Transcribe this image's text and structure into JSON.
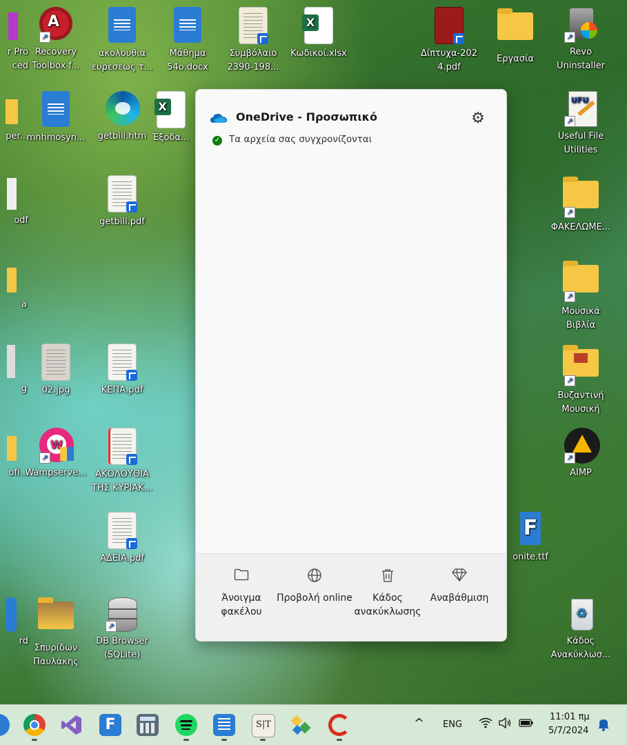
{
  "desktop": {
    "col0": {
      "label_row1": "r Pro\nced",
      "label_row2": "per...",
      "label_row3": "odf",
      "label_row4": "a",
      "label_row5": "g",
      "label_row6": "ofi...",
      "label_row7": "rd"
    },
    "col1": {
      "recovery": "Recovery Toolbox f...",
      "mnhmosyn": "mnhmosyn...",
      "jpg02": "02.jpg",
      "wampserver": "Wampserve...",
      "spyridon": "Σπυρίδων Παυλάκης"
    },
    "col2": {
      "akolouthia": "ακολουθια ευρεσεως τ...",
      "getbill_htm": "getbill.htm",
      "getbill_pdf": "getbill.pdf",
      "kepa": "ΚΕΠΑ.pdf",
      "akolouthia_kyriak": "ΑΚΟΛΟΥΘΙΑ ΤΗΣ ΚΥΡΙΑΚ...",
      "adeia": "ΑΔΕΙΑ.pdf",
      "dbbrowser": "DB Browser (SQLite)"
    },
    "col3": {
      "mathima": "Μάθημα 54ο.docx",
      "exoda": "Έξοδα..."
    },
    "col4": {
      "symvolaio": "Συμβόλαιο 2390-198..."
    },
    "col5": {
      "kodikoi": "Κωδικοί.xlsx"
    },
    "col6": {
      "diptyxa": "Δίπτυχα-2024.pdf"
    },
    "col7": {
      "ergasia": "Εργασία"
    },
    "col8": {
      "revo": "Revo Uninstaller",
      "useful": "Useful File Utilities",
      "fakelomeni": "ΦΑΚΕΛΩΜΕ...",
      "mousika": "Μουσικά Βιβλία",
      "vyzantini": "Βυζαντινή Μουσική",
      "aimp": "AIMP",
      "font": "onite.ttf",
      "kados": "Κάδος Ανακύκλωσ..."
    }
  },
  "onedrive": {
    "title": "OneDrive - Προσωπικό",
    "status": "Τα αρχεία σας συγχρονίζονται",
    "buttons": [
      {
        "label": "Άνοιγμα φακέλου",
        "icon": "folder-icon"
      },
      {
        "label": "Προβολή online",
        "icon": "globe-icon"
      },
      {
        "label": "Κάδος ανακύκλωσης",
        "icon": "trash-icon"
      },
      {
        "label": "Αναβάθμιση",
        "icon": "diamond-icon"
      }
    ]
  },
  "taskbar": {
    "language": "ENG",
    "time": "11:01 πμ",
    "date": "5/7/2024",
    "chevron": "^"
  },
  "colors": {
    "onedrive_blue": "#0f6cbd",
    "sync_green": "#107c10",
    "taskbar_bg": "#d6e8d6"
  }
}
